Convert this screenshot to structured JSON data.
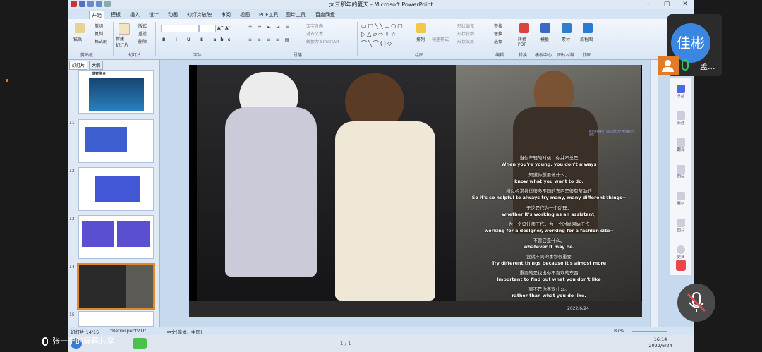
{
  "window": {
    "title": "大三那年的夏天 - Microsoft PowerPoint",
    "controls": [
      "–",
      "▢",
      "✕"
    ]
  },
  "ribbon_tabs": [
    "开始",
    "插入",
    "设计",
    "动画",
    "幻灯片放映",
    "审阅",
    "视图",
    "PDF工具",
    "图片工具",
    "百度网盘"
  ],
  "ribbon_tabs_visible": [
    "开始",
    "模板",
    "插入",
    "设计",
    "动画",
    "幻灯片放映",
    "审阅",
    "视图",
    "PDF工具",
    "图片工具",
    "百度网盘"
  ],
  "ribbon": {
    "clipboard": {
      "paste": "粘贴",
      "cut": "剪切",
      "copy": "复制",
      "format_painter": "格式刷",
      "label": "剪贴板"
    },
    "slides": {
      "new_slide": "新建\n幻灯片",
      "layout": "版式",
      "reset": "重设",
      "delete": "删除",
      "label": "幻灯片"
    },
    "font_label": "字体",
    "paragraph_label": "段落",
    "paragraph_items": [
      "文字方向",
      "对齐文本",
      "转换为 SmartArt"
    ],
    "drawing_label": "绘图",
    "drawing_items": [
      "排列",
      "快速样式",
      "形状填充",
      "形状轮廓",
      "形状效果"
    ],
    "editing": {
      "find": "查找",
      "replace": "替换",
      "select": "选择",
      "label": "编辑"
    },
    "other": {
      "pdf": "转换\nPDF",
      "template": "模板",
      "material": "素材",
      "flow": "流程图",
      "convert_label": "转换",
      "template_center": "模板中心",
      "image_label": "图片材料",
      "works": "作图"
    }
  },
  "left_pane": {
    "tabs": [
      "幻灯片",
      "大纲"
    ],
    "thumbnails": [
      {
        "num": "",
        "title": "晚宴拼合"
      },
      {
        "num": "11",
        "title": ""
      },
      {
        "num": "12",
        "title": ""
      },
      {
        "num": "13",
        "title": ""
      },
      {
        "num": "14",
        "title": ""
      },
      {
        "num": "15",
        "title": ""
      }
    ]
  },
  "slide": {
    "date": "2022/6/24",
    "small_note": "那些我们曾经一起走过的日子 现在都成了回忆",
    "captions": [
      {
        "zh": "当你年轻的时候，你并不总是",
        "en": "When you're young, you don't always"
      },
      {
        "zh": "知道你想要做什么，",
        "en": "know what you want to do."
      },
      {
        "zh": "所以经常尝试很多不同的东西是很有帮助的",
        "en": "So it's so helpful to always try many, many different things--"
      },
      {
        "zh": "无论是作为一个助理，",
        "en": "whether it's working as an assistant,"
      },
      {
        "zh": "为一个设计师工作，为一个时尚网站工作",
        "en": "working for a designer, working for a fashion site--"
      },
      {
        "zh": "不管它是什么。",
        "en": "whatever it may be."
      },
      {
        "zh": "尝试不同的事物很重要",
        "en": "Try different things because it's almost more"
      },
      {
        "zh": "重要的是找出你不喜欢的东西",
        "en": "important to find out what you don't like"
      },
      {
        "zh": "而不是你喜欢什么。",
        "en": "rather than what you do like."
      }
    ]
  },
  "statusbar": {
    "slide_info": "幻灯片 14/15",
    "theme": "\"RetrospectVTI\"",
    "language": "中文(简体，中国)",
    "zoom": "87%"
  },
  "taskbar": {
    "time": "16:14",
    "date": "2022/6/24",
    "page_indicator": "1 / 1"
  },
  "meeting": {
    "avatar_name": "佳彬",
    "participant": "孟...",
    "share_label": "张一宁的屏幕共享",
    "sidebar": [
      "总结",
      "新建",
      "翻译",
      "图标",
      "素材",
      "图片",
      "更多"
    ]
  },
  "colors": {
    "ppt_accent": "#e28a2a",
    "avatar_blue": "#3a86e0",
    "mute_red": "#e5484d"
  }
}
